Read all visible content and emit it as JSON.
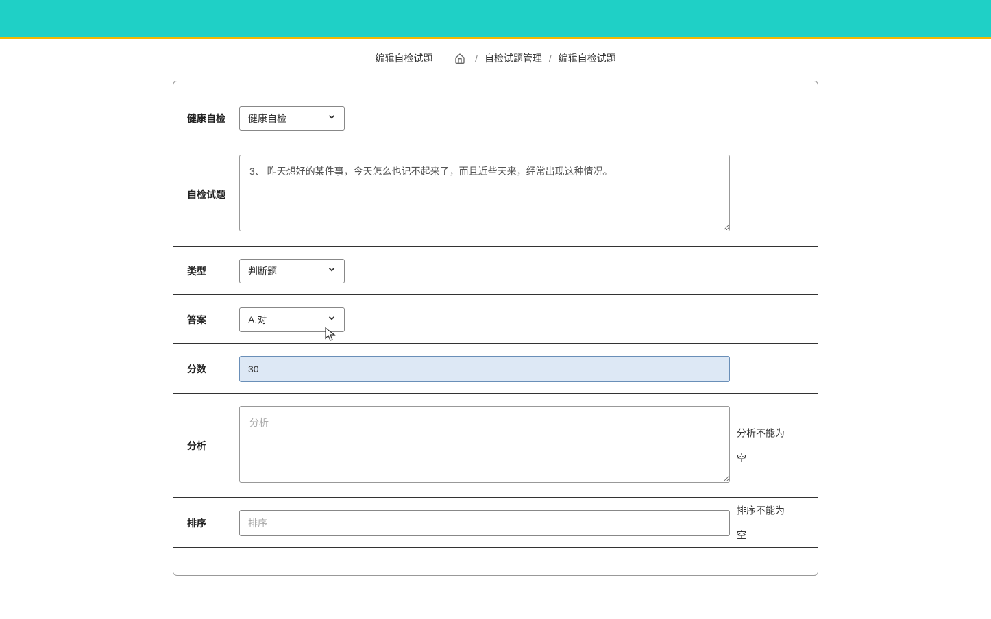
{
  "header": {
    "page_title": "编辑自检试题"
  },
  "breadcrumb": {
    "link1": "自检试题管理",
    "link2": "编辑自检试题"
  },
  "form": {
    "category": {
      "label": "健康自检",
      "value": "健康自检"
    },
    "question": {
      "label": "自检试题",
      "value": "3、 昨天想好的某件事，今天怎么也记不起来了，而且近些天来，经常出现这种情况。"
    },
    "type": {
      "label": "类型",
      "value": "判断题"
    },
    "answer": {
      "label": "答案",
      "value": "A.对"
    },
    "score": {
      "label": "分数",
      "value": "30"
    },
    "analysis": {
      "label": "分析",
      "placeholder": "分析",
      "error": "分析不能为空"
    },
    "sort": {
      "label": "排序",
      "placeholder": "排序",
      "error": "排序不能为空"
    }
  }
}
